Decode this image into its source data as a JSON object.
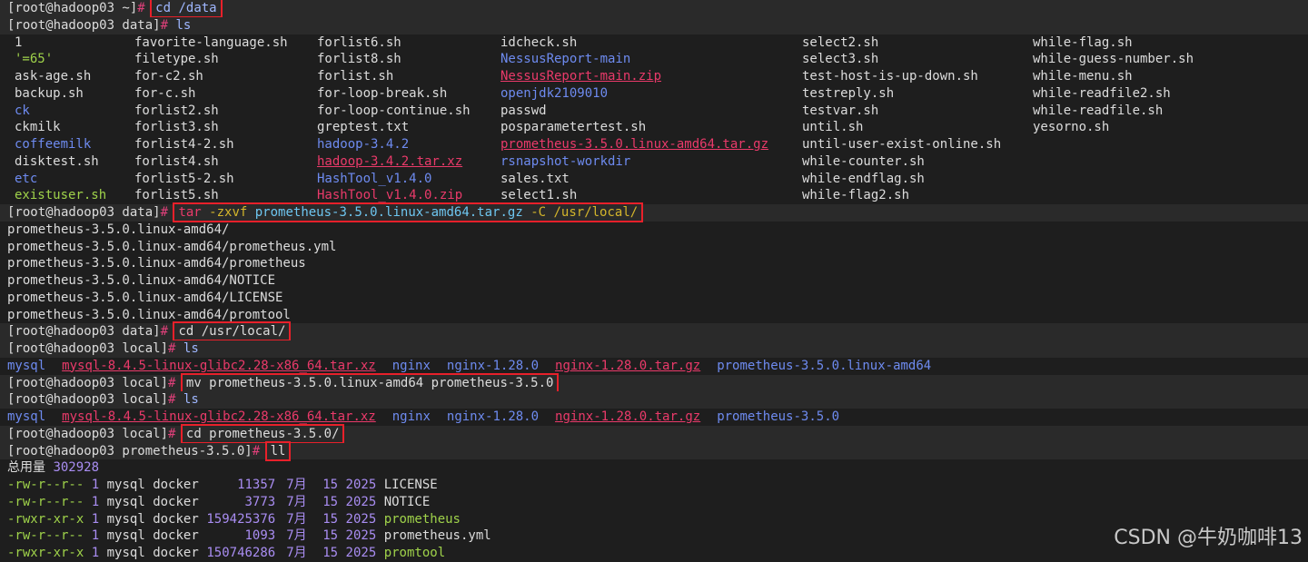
{
  "terminal": {
    "lines": [
      {
        "type": "cmd",
        "prompt": "[root@hadoop03 ~]",
        "command": "cd /data",
        "highlight": true
      },
      {
        "type": "cmd",
        "prompt": "[root@hadoop03 data]",
        "command": "ls",
        "highlight": false
      },
      {
        "type": "ls",
        "cols": [
          {
            "text": "1",
            "color": "white"
          },
          {
            "text": "favorite-language.sh",
            "color": "white"
          },
          {
            "text": "forlist6.sh",
            "color": "white"
          },
          {
            "text": "idcheck.sh",
            "color": "white"
          },
          {
            "text": "select2.sh",
            "color": "white"
          },
          {
            "text": "while-flag.sh",
            "color": "white"
          }
        ]
      },
      {
        "type": "ls",
        "cols": [
          {
            "text": "'=65'",
            "color": "green"
          },
          {
            "text": "filetype.sh",
            "color": "white"
          },
          {
            "text": "forlist8.sh",
            "color": "white"
          },
          {
            "text": "NessusReport-main",
            "color": "blue"
          },
          {
            "text": "select3.sh",
            "color": "white"
          },
          {
            "text": "while-guess-number.sh",
            "color": "white"
          }
        ]
      },
      {
        "type": "ls",
        "cols": [
          {
            "text": "ask-age.sh",
            "color": "white"
          },
          {
            "text": "for-c2.sh",
            "color": "white"
          },
          {
            "text": "forlist.sh",
            "color": "white"
          },
          {
            "text": "NessusReport-main.zip",
            "color": "red"
          },
          {
            "text": "test-host-is-up-down.sh",
            "color": "white"
          },
          {
            "text": "while-menu.sh",
            "color": "white"
          }
        ]
      },
      {
        "type": "ls",
        "cols": [
          {
            "text": "backup.sh",
            "color": "white"
          },
          {
            "text": "for-c.sh",
            "color": "white"
          },
          {
            "text": "for-loop-break.sh",
            "color": "white"
          },
          {
            "text": "openjdk2109010",
            "color": "blue"
          },
          {
            "text": "testreply.sh",
            "color": "white"
          },
          {
            "text": "while-readfile2.sh",
            "color": "white"
          }
        ]
      },
      {
        "type": "ls",
        "cols": [
          {
            "text": "ck",
            "color": "blue"
          },
          {
            "text": "forlist2.sh",
            "color": "white"
          },
          {
            "text": "for-loop-continue.sh",
            "color": "white"
          },
          {
            "text": "passwd",
            "color": "white"
          },
          {
            "text": "testvar.sh",
            "color": "white"
          },
          {
            "text": "while-readfile.sh",
            "color": "white"
          }
        ]
      },
      {
        "type": "ls",
        "cols": [
          {
            "text": "ckmilk",
            "color": "white"
          },
          {
            "text": "forlist3.sh",
            "color": "white"
          },
          {
            "text": "greptest.txt",
            "color": "white"
          },
          {
            "text": "posparametertest.sh",
            "color": "white"
          },
          {
            "text": "until.sh",
            "color": "white"
          },
          {
            "text": "yesorno.sh",
            "color": "white"
          }
        ]
      },
      {
        "type": "ls",
        "cols": [
          {
            "text": "coffeemilk",
            "color": "blue"
          },
          {
            "text": "forlist4-2.sh",
            "color": "white"
          },
          {
            "text": "hadoop-3.4.2",
            "color": "blue"
          },
          {
            "text": "prometheus-3.5.0.linux-amd64.tar.gz",
            "color": "red"
          },
          {
            "text": "until-user-exist-online.sh",
            "color": "white"
          },
          {
            "text": "",
            "color": "white"
          }
        ]
      },
      {
        "type": "ls",
        "cols": [
          {
            "text": "disktest.sh",
            "color": "white"
          },
          {
            "text": "forlist4.sh",
            "color": "white"
          },
          {
            "text": "hadoop-3.4.2.tar.xz",
            "color": "red"
          },
          {
            "text": "rsnapshot-workdir",
            "color": "blue"
          },
          {
            "text": "while-counter.sh",
            "color": "white"
          },
          {
            "text": "",
            "color": "white"
          }
        ]
      },
      {
        "type": "ls",
        "cols": [
          {
            "text": "etc",
            "color": "blue"
          },
          {
            "text": "forlist5-2.sh",
            "color": "white"
          },
          {
            "text": "HashTool_v1.4.0",
            "color": "blue"
          },
          {
            "text": "sales.txt",
            "color": "white"
          },
          {
            "text": "while-endflag.sh",
            "color": "white"
          },
          {
            "text": "",
            "color": "white"
          }
        ]
      },
      {
        "type": "ls",
        "cols": [
          {
            "text": "existuser.sh",
            "color": "green"
          },
          {
            "text": "forlist5.sh",
            "color": "white"
          },
          {
            "text": "HashTool_v1.4.0.zip",
            "color": "pinkplain"
          },
          {
            "text": "select1.sh",
            "color": "white"
          },
          {
            "text": "while-flag2.sh",
            "color": "white"
          },
          {
            "text": "",
            "color": "white"
          }
        ]
      },
      {
        "type": "cmd",
        "prompt": "[root@hadoop03 data]",
        "command": "tar -zxvf prometheus-3.5.0.linux-amd64.tar.gz -C /usr/local/",
        "highlight": true,
        "tar": true
      },
      {
        "type": "out",
        "text": "prometheus-3.5.0.linux-amd64/"
      },
      {
        "type": "out",
        "text": "prometheus-3.5.0.linux-amd64/prometheus.yml"
      },
      {
        "type": "out",
        "text": "prometheus-3.5.0.linux-amd64/prometheus"
      },
      {
        "type": "out",
        "text": "prometheus-3.5.0.linux-amd64/NOTICE"
      },
      {
        "type": "out",
        "text": "prometheus-3.5.0.linux-amd64/LICENSE"
      },
      {
        "type": "out",
        "text": "prometheus-3.5.0.linux-amd64/promtool"
      },
      {
        "type": "cmd",
        "prompt": "[root@hadoop03 data]",
        "command": "cd /usr/local/",
        "highlight": true
      },
      {
        "type": "cmd",
        "prompt": "[root@hadoop03 local]",
        "command": "ls",
        "highlight": false
      },
      {
        "type": "inline",
        "items": [
          {
            "text": "mysql",
            "color": "blue"
          },
          {
            "text": "mysql-8.4.5-linux-glibc2.28-x86_64.tar.xz",
            "color": "red"
          },
          {
            "text": "nginx",
            "color": "blue"
          },
          {
            "text": "nginx-1.28.0",
            "color": "blue"
          },
          {
            "text": "nginx-1.28.0.tar.gz",
            "color": "red"
          },
          {
            "text": "prometheus-3.5.0.linux-amd64",
            "color": "blue"
          }
        ]
      },
      {
        "type": "cmd",
        "prompt": "[root@hadoop03 local]",
        "command": "mv prometheus-3.5.0.linux-amd64 prometheus-3.5.0",
        "highlight": true
      },
      {
        "type": "cmd",
        "prompt": "[root@hadoop03 local]",
        "command": "ls",
        "highlight": false
      },
      {
        "type": "inline",
        "items": [
          {
            "text": "mysql",
            "color": "blue"
          },
          {
            "text": "mysql-8.4.5-linux-glibc2.28-x86_64.tar.xz",
            "color": "red"
          },
          {
            "text": "nginx",
            "color": "blue"
          },
          {
            "text": "nginx-1.28.0",
            "color": "blue"
          },
          {
            "text": "nginx-1.28.0.tar.gz",
            "color": "red"
          },
          {
            "text": "prometheus-3.5.0",
            "color": "blue"
          }
        ]
      },
      {
        "type": "cmd",
        "prompt": "[root@hadoop03 local]",
        "command": "cd prometheus-3.5.0/",
        "highlight": true
      },
      {
        "type": "cmd",
        "prompt": "[root@hadoop03 prometheus-3.5.0]",
        "command": "ll",
        "highlight": true
      },
      {
        "type": "total",
        "label": "总用量",
        "value": "302928"
      },
      {
        "type": "ll",
        "perm": "-rw-r--r--",
        "links": "1",
        "owner": "mysql",
        "group": "docker",
        "size": "11357",
        "month": "7月",
        "day": "15",
        "year": "2025",
        "name": "LICENSE",
        "exec": false
      },
      {
        "type": "ll",
        "perm": "-rw-r--r--",
        "links": "1",
        "owner": "mysql",
        "group": "docker",
        "size": "3773",
        "month": "7月",
        "day": "15",
        "year": "2025",
        "name": "NOTICE",
        "exec": false
      },
      {
        "type": "ll",
        "perm": "-rwxr-xr-x",
        "links": "1",
        "owner": "mysql",
        "group": "docker",
        "size": "159425376",
        "month": "7月",
        "day": "15",
        "year": "2025",
        "name": "prometheus",
        "exec": true
      },
      {
        "type": "ll",
        "perm": "-rw-r--r--",
        "links": "1",
        "owner": "mysql",
        "group": "docker",
        "size": "1093",
        "month": "7月",
        "day": "15",
        "year": "2025",
        "name": "prometheus.yml",
        "exec": false
      },
      {
        "type": "ll",
        "perm": "-rwxr-xr-x",
        "links": "1",
        "owner": "mysql",
        "group": "docker",
        "size": "150746286",
        "month": "7月",
        "day": "15",
        "year": "2025",
        "name": "promtool",
        "exec": true
      }
    ]
  },
  "watermark": "CSDN @牛奶咖啡13",
  "colors": {
    "background": "#1e1e1e",
    "text": "#dcdcdc",
    "prompt_hash": "#e0407a",
    "directory": "#6e8bf0",
    "archive": "#ea3a6a",
    "executable": "#9fd24a",
    "highlight_box": "#e8202a"
  }
}
